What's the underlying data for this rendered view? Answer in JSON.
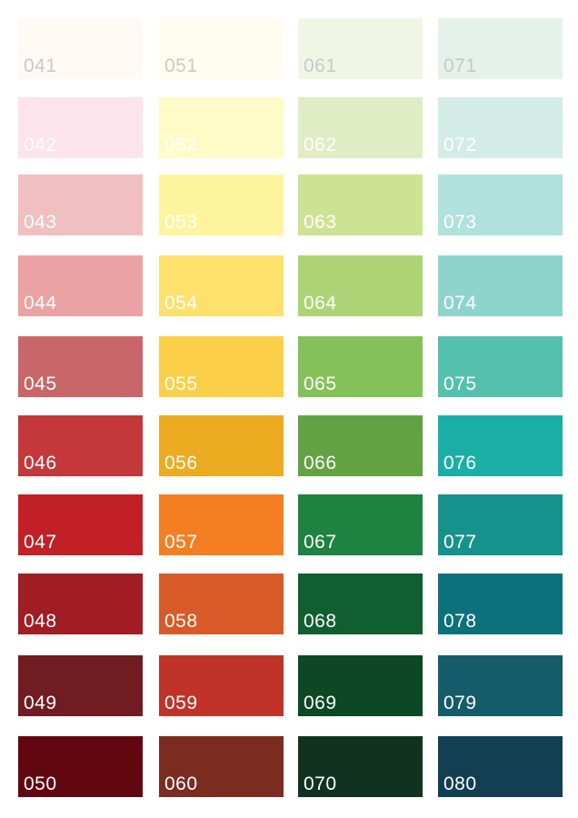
{
  "swatches": [
    {
      "code": "041",
      "color": "#fef9f5",
      "light": true
    },
    {
      "code": "042",
      "color": "#fde3ec",
      "light": false
    },
    {
      "code": "043",
      "color": "#f0c0c0",
      "light": false
    },
    {
      "code": "044",
      "color": "#eba2a2",
      "light": false
    },
    {
      "code": "045",
      "color": "#c9666a",
      "light": false
    },
    {
      "code": "046",
      "color": "#c4383c",
      "light": false
    },
    {
      "code": "047",
      "color": "#c12026",
      "light": false
    },
    {
      "code": "048",
      "color": "#a01d23",
      "light": false
    },
    {
      "code": "049",
      "color": "#711b23",
      "light": false
    },
    {
      "code": "050",
      "color": "#620610",
      "light": false
    },
    {
      "code": "051",
      "color": "#fffdf0",
      "light": true
    },
    {
      "code": "052",
      "color": "#fffbc7",
      "light": false
    },
    {
      "code": "053",
      "color": "#fef49d",
      "light": false
    },
    {
      "code": "054",
      "color": "#fee16d",
      "light": false
    },
    {
      "code": "055",
      "color": "#fccf48",
      "light": false
    },
    {
      "code": "056",
      "color": "#ecab21",
      "light": false
    },
    {
      "code": "057",
      "color": "#f47f22",
      "light": false
    },
    {
      "code": "058",
      "color": "#d85a28",
      "light": false
    },
    {
      "code": "059",
      "color": "#c03328",
      "light": false
    },
    {
      "code": "060",
      "color": "#7b2b20",
      "light": false
    },
    {
      "code": "061",
      "color": "#f1f6e4",
      "light": true
    },
    {
      "code": "062",
      "color": "#e0edc4",
      "light": false
    },
    {
      "code": "063",
      "color": "#cee293",
      "light": false
    },
    {
      "code": "064",
      "color": "#acd475",
      "light": false
    },
    {
      "code": "065",
      "color": "#84c159",
      "light": false
    },
    {
      "code": "066",
      "color": "#62a242",
      "light": false
    },
    {
      "code": "067",
      "color": "#1e8241",
      "light": false
    },
    {
      "code": "068",
      "color": "#115f30",
      "light": false
    },
    {
      "code": "069",
      "color": "#0c4823",
      "light": false
    },
    {
      "code": "070",
      "color": "#113220",
      "light": false
    },
    {
      "code": "071",
      "color": "#e4f2eb",
      "light": true
    },
    {
      "code": "072",
      "color": "#d3ece5",
      "light": false
    },
    {
      "code": "073",
      "color": "#b1e1dc",
      "light": false
    },
    {
      "code": "074",
      "color": "#8ed4cc",
      "light": false
    },
    {
      "code": "075",
      "color": "#54c0ae",
      "light": false
    },
    {
      "code": "076",
      "color": "#1aafa6",
      "light": false
    },
    {
      "code": "077",
      "color": "#15928b",
      "light": false
    },
    {
      "code": "078",
      "color": "#0d717c",
      "light": false
    },
    {
      "code": "079",
      "color": "#155c6b",
      "light": false
    },
    {
      "code": "080",
      "color": "#123f52",
      "light": false
    }
  ]
}
